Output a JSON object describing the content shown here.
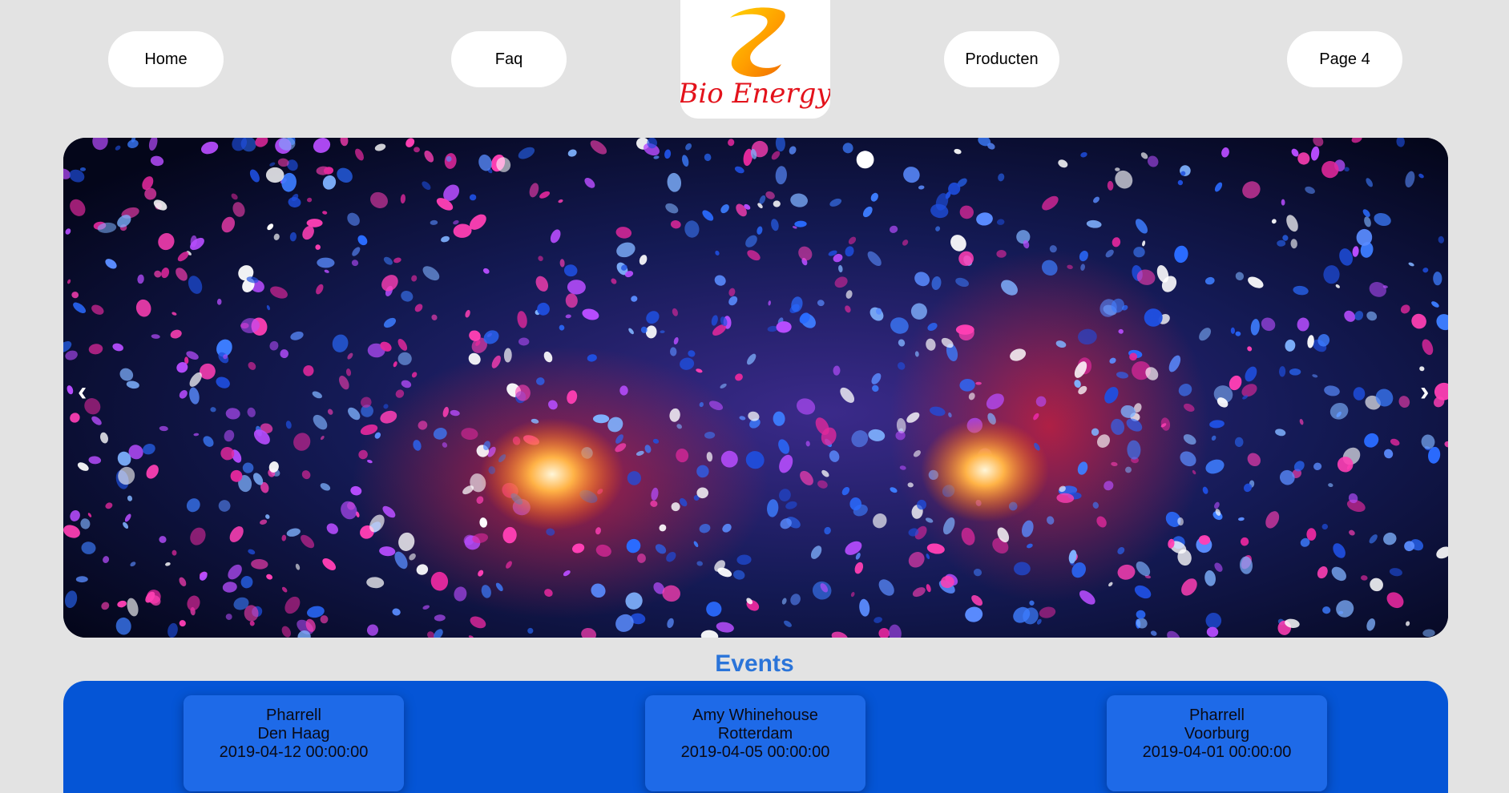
{
  "nav": {
    "items": [
      {
        "label": "Home"
      },
      {
        "label": "Faq"
      },
      {
        "label": "Producten"
      },
      {
        "label": "Page 4"
      }
    ]
  },
  "logo": {
    "text": "Bio Energy",
    "brand_color": "#e3121b",
    "swirl_color": "#f5a300"
  },
  "carousel": {
    "prev_label": "‹",
    "next_label": "›"
  },
  "events": {
    "title": "Events",
    "items": [
      {
        "artist": "Pharrell",
        "city": "Den Haag",
        "date": "2019-04-12 00:00:00"
      },
      {
        "artist": "Amy Whinehouse",
        "city": "Rotterdam",
        "date": "2019-04-05 00:00:00"
      },
      {
        "artist": "Pharrell",
        "city": "Voorburg",
        "date": "2019-04-01 00:00:00"
      }
    ]
  },
  "colors": {
    "page_bg": "#e3e3e3",
    "events_panel": "#0555d6",
    "event_card": "#1e6ae8",
    "events_title": "#2a74d9"
  }
}
